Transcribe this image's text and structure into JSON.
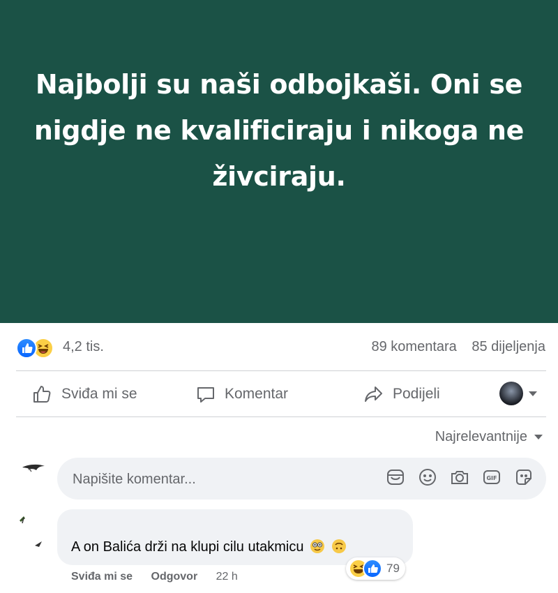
{
  "post": {
    "banner_text": "Najbolji su naši odbojkaši. Oni se nigdje ne kvalificiraju i nikoga ne živciraju.",
    "background_color": "#1b5246",
    "reactions_count": "4,2 tis.",
    "comments_count": "89 komentara",
    "shares_count": "85 dijeljenja"
  },
  "actions": {
    "like_label": "Sviđa mi se",
    "comment_label": "Komentar",
    "share_label": "Podijeli"
  },
  "sort": {
    "label": "Najrelevantnije"
  },
  "composer": {
    "placeholder": "Napišite komentar...",
    "icons": [
      "sticker-icon",
      "emoji-icon",
      "camera-icon",
      "gif-icon",
      "sticker-face-icon"
    ]
  },
  "comment": {
    "text": "A on Balića drži na klupi cilu utakmicu",
    "reaction_count": "79",
    "like_label": "Sviđa mi se",
    "reply_label": "Odgovor",
    "time": "22 h"
  },
  "colors": {
    "accent": "#0866ff",
    "muted_text": "#65676b",
    "input_bg": "#f0f2f5"
  }
}
